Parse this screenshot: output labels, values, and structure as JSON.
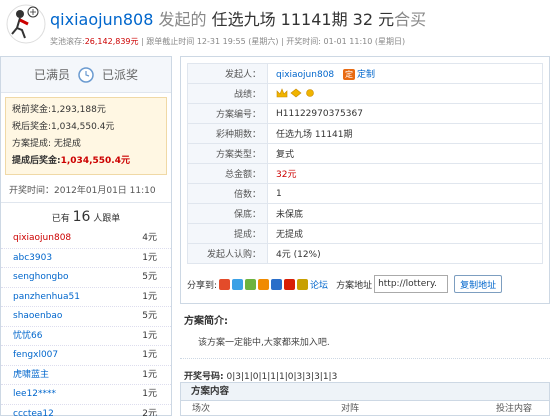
{
  "header": {
    "username": "qixiaojun808",
    "initiated": "发起的",
    "game": "任选九场 11141期",
    "amount": "32 元",
    "type": "合买",
    "jackpot_label": "奖池滚存:",
    "jackpot_value": "26,142,839元",
    "deadline": "| 跟单截止时间 12-31 19:55 (星期六) | 开奖时间: 01-01 11:10 (星期日)"
  },
  "left": {
    "tab_full": "已满员",
    "tab_paid": "已派奖",
    "pretax": "税前奖金:1,293,188元",
    "aftertax": "税后奖金:1,034,550.4元",
    "commission": "方案提成: 无提成",
    "final_label": "提成后奖金:",
    "final_value": "1,034,550.4元",
    "open_time": "开奖时间：2012年01月01日 11:10",
    "followers_pre": "已有",
    "followers_count": "16",
    "followers_post": "人跟单",
    "followers": [
      {
        "name": "qixiaojun808",
        "amount": "4元"
      },
      {
        "name": "abc3903",
        "amount": "1元"
      },
      {
        "name": "senghongbo",
        "amount": "5元"
      },
      {
        "name": "panzhenhua51",
        "amount": "1元"
      },
      {
        "name": "shaoenbao",
        "amount": "5元"
      },
      {
        "name": "忧忧66",
        "amount": "1元"
      },
      {
        "name": "fengxl007",
        "amount": "1元"
      },
      {
        "name": "虎啸蓝主",
        "amount": "1元"
      },
      {
        "name": "lee12****",
        "amount": "1元"
      },
      {
        "name": "ccctea12",
        "amount": "2元"
      }
    ]
  },
  "info": {
    "rows": [
      {
        "label": "发起人：",
        "value": "qixiaojun808"
      },
      {
        "label": "战绩：",
        "value": ""
      },
      {
        "label": "方案编号：",
        "value": "H11122970375367"
      },
      {
        "label": "彩种期数：",
        "value": "任选九场 11141期"
      },
      {
        "label": "方案类型：",
        "value": "复式"
      },
      {
        "label": "总金额：",
        "value": "32元"
      },
      {
        "label": "倍数：",
        "value": "1"
      },
      {
        "label": "保底：",
        "value": "未保底"
      },
      {
        "label": "提成：",
        "value": "无提成"
      },
      {
        "label": "发起人认购：",
        "value": "4元 (12%)"
      }
    ],
    "custom_tag": "定",
    "custom_label": "定制"
  },
  "share": {
    "label": "分享到:",
    "forum": "论坛",
    "addr_label": "方案地址",
    "url": "http://lottery.",
    "copy": "复制地址"
  },
  "intro": {
    "title": "方案简介:",
    "text": "该方案一定能中,大家都来加入吧."
  },
  "win": {
    "label": "开奖号码:",
    "numbers": "0|3|1|0|1|1|1|0|3|3|3|1|3"
  },
  "content": {
    "title": "方案内容",
    "col1": "场次",
    "col2": "对阵",
    "col3": "投注内容"
  },
  "colors": {
    "link": "#0066cc",
    "accent": "#cc0000",
    "tag": "#e86a12"
  }
}
